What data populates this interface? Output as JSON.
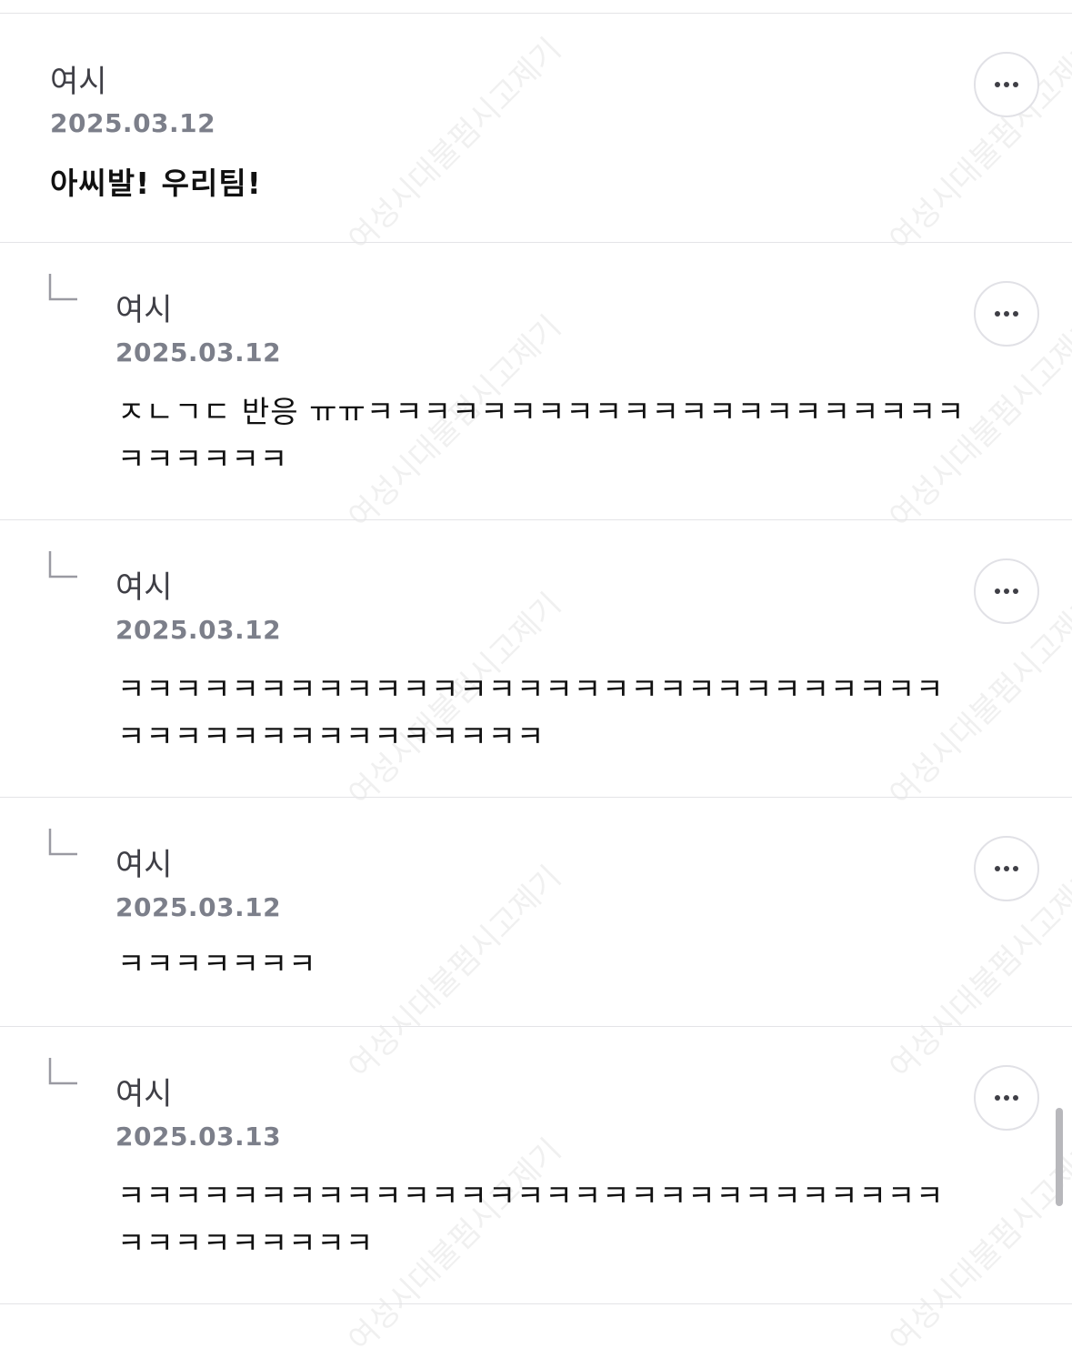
{
  "comments": [
    {
      "author": "여시",
      "date": "2025.03.12",
      "text": "아씨발! 우리팀!"
    },
    {
      "author": "여시",
      "date": "2025.03.12",
      "line1": "ㅈㄴㄱㄷ 반응 ㅠㅠㅋㅋㅋㅋㅋㅋㅋㅋㅋㅋㅋㅋㅋㅋㅋㅋㅋㅋㅋㅋㅋ",
      "line2": "ㅋㅋㅋㅋㅋㅋ"
    },
    {
      "author": "여시",
      "date": "2025.03.12",
      "line1": "ㅋㅋㅋㅋㅋㅋㅋㅋㅋㅋㅋㅋㅋㅋㅋㅋㅋㅋㅋㅋㅋㅋㅋㅋㅋㅋㅋㅋㅋ",
      "line2": "ㅋㅋㅋㅋㅋㅋㅋㅋㅋㅋㅋㅋㅋㅋㅋ"
    },
    {
      "author": "여시",
      "date": "2025.03.12",
      "text": "ㅋㅋㅋㅋㅋㅋㅋ"
    },
    {
      "author": "여시",
      "date": "2025.03.13",
      "line1": "ㅋㅋㅋㅋㅋㅋㅋㅋㅋㅋㅋㅋㅋㅋㅋㅋㅋㅋㅋㅋㅋㅋㅋㅋㅋㅋㅋㅋㅋ",
      "line2": "ㅋㅋㅋㅋㅋㅋㅋㅋㅋ"
    }
  ],
  "watermark": "여성시대불펌시고제기",
  "icons": {
    "more": "more-horizontal-icon",
    "reply": "reply-arrow-icon"
  },
  "colors": {
    "author": "#3f3f46",
    "date": "#7c7f8a",
    "divider": "#e4e4e7"
  }
}
